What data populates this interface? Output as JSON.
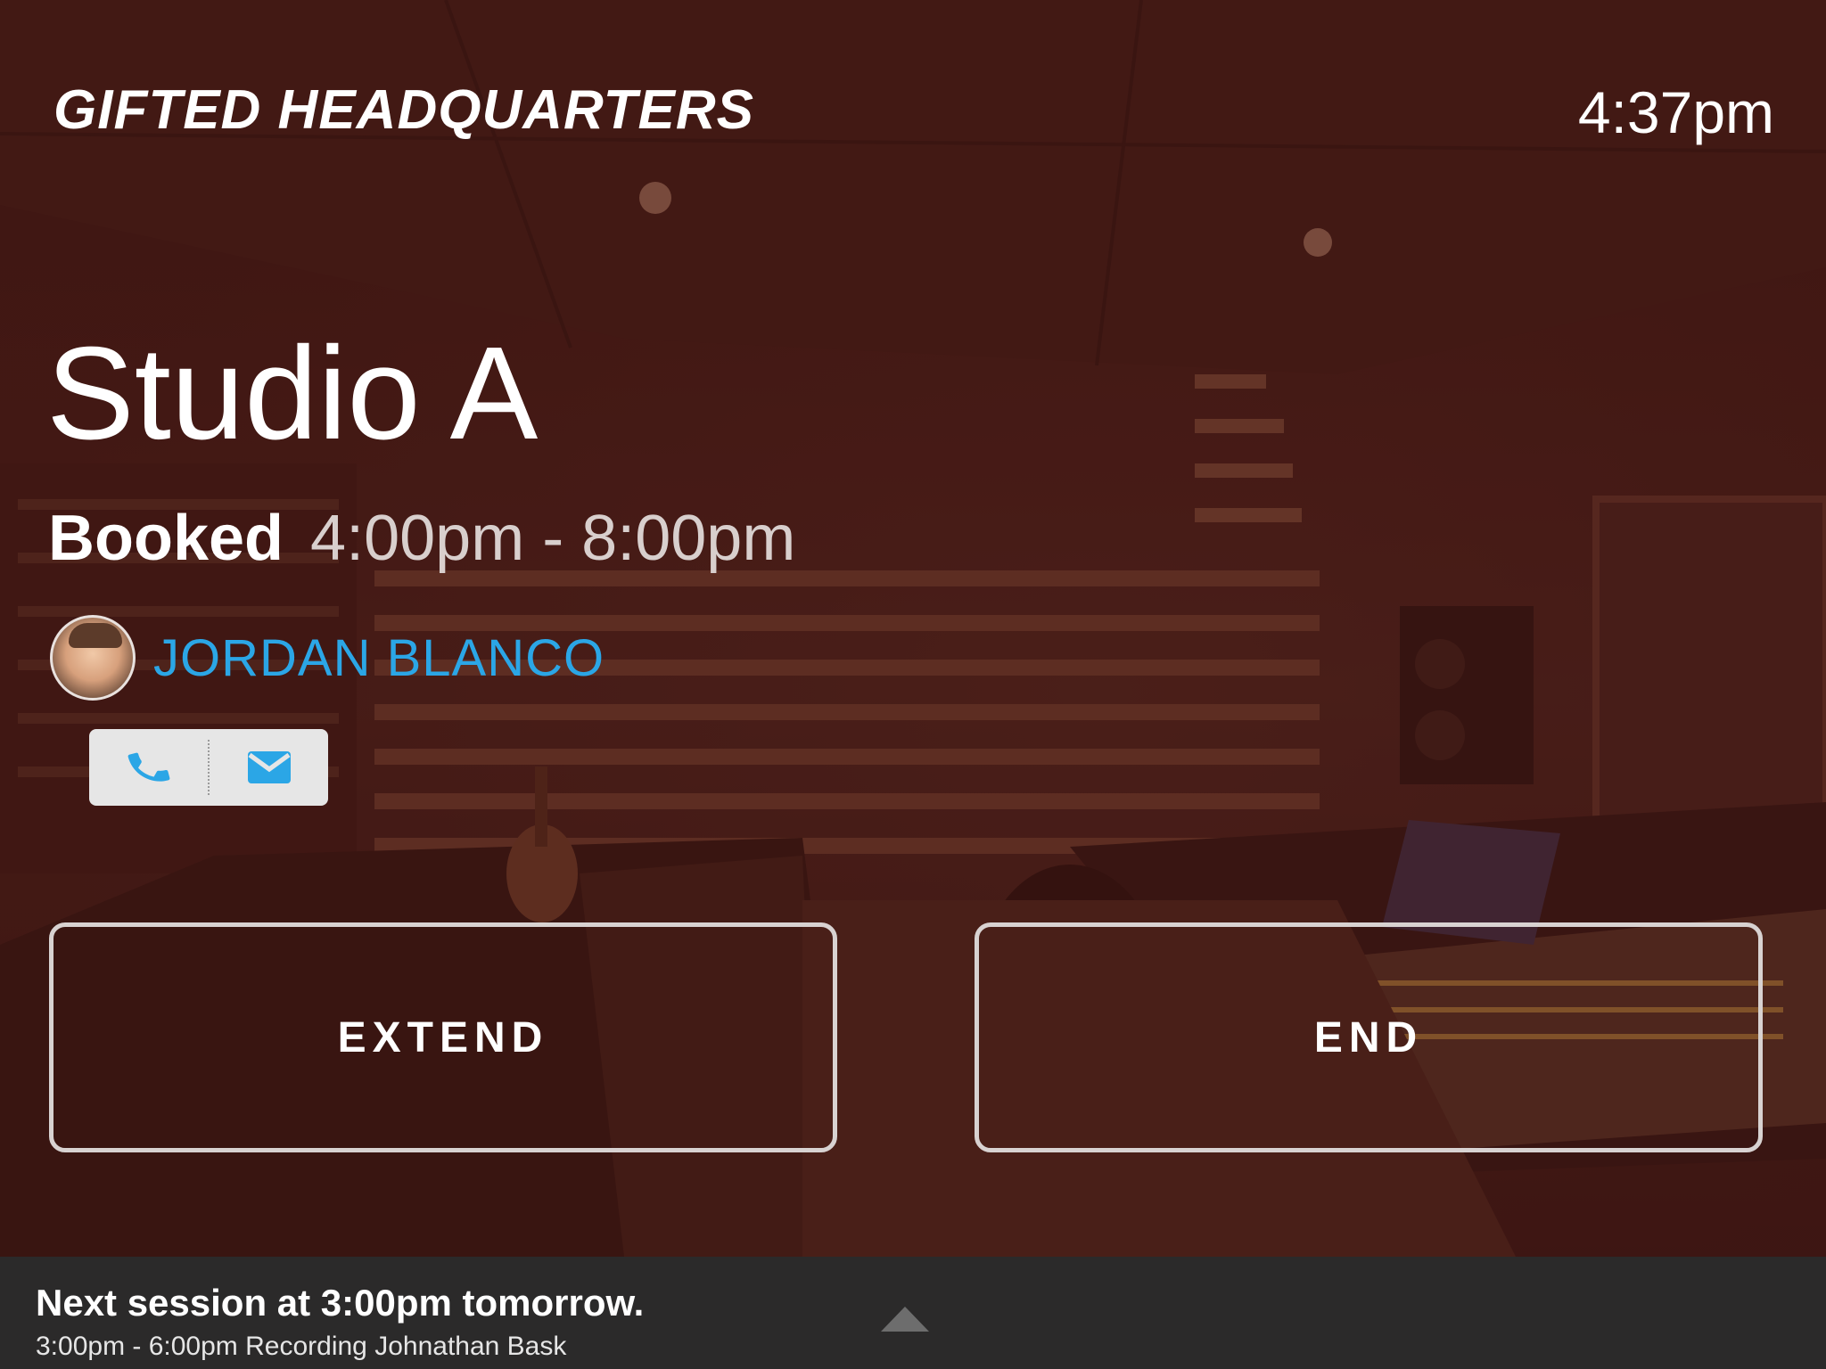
{
  "header": {
    "venue": "GIFTED HEADQUARTERS",
    "time": "4:37pm"
  },
  "room": {
    "name": "Studio A",
    "status": "Booked",
    "time_range": "4:00pm - 8:00pm"
  },
  "host": {
    "name": "JORDAN BLANCO"
  },
  "contact": {
    "phone_icon": "phone-icon",
    "email_icon": "envelope-icon",
    "icon_color": "#2ba6e6"
  },
  "actions": {
    "extend_label": "EXTEND",
    "end_label": "END"
  },
  "footer": {
    "next_title": "Next session at 3:00pm tomorrow.",
    "next_detail": "3:00pm - 6:00pm Recording Johnathan Bask",
    "toggle_icon": "chevron-up-icon"
  }
}
